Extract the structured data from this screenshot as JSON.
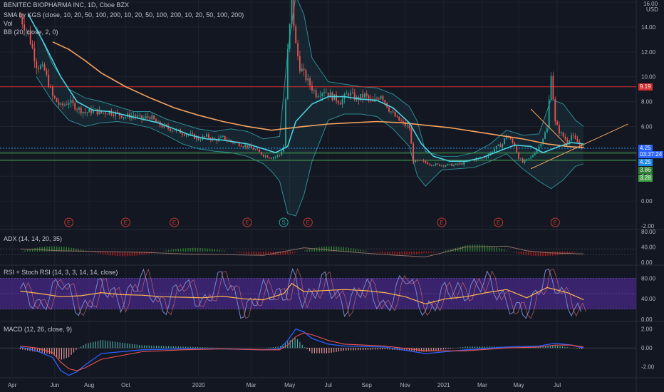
{
  "legend": {
    "title": "BENITEC BIOPHARMA INC, 1D, Cboe BZX",
    "sma": "SMA by KGS (close, 10, 20, 50, 100, 200, 10, 20, 50, 100, 200, 10, 20, 50, 100, 200)",
    "vol": "Vol",
    "bb": "BB (20, close, 2, 0)",
    "adx": "ADX (14, 14, 20, 35)",
    "rsi": "RSI + Stoch RSI (14, 3, 3, 14, 14, close)",
    "macd": "MACD (12, 26, close, 9)"
  },
  "price_tags": {
    "top": "16.00",
    "currency": "USD",
    "resistance": "9.19",
    "last": "4.25",
    "countdown": "03:37:24",
    "last2": "4.25",
    "support1": "3.86",
    "support2": "3.28"
  },
  "colors": {
    "background": "#131722",
    "grid": "#1e222d",
    "candle_up": "#26a69a",
    "candle_down": "#ef5350",
    "sma_orange": "#f5a25d",
    "sma_blue": "#4dd0e1",
    "bollinger": "#2e8b94",
    "resistance": "#d32f2f",
    "support": "#2e7d32",
    "earnings": "#c0392b",
    "rsi_band": "#4a2a8c",
    "macd_line": "#2962ff",
    "signal_line": "#ef5350"
  },
  "events": {
    "earnings_label": "E",
    "split_label": "S"
  },
  "chart_data": [
    {
      "type": "candlestick",
      "name": "price",
      "x_labels": [
        "Apr",
        "Jun",
        "Aug",
        "Oct",
        "2020",
        "Mar",
        "May",
        "Jul",
        "Sep",
        "Nov",
        "2021",
        "Mar",
        "May",
        "Jul"
      ],
      "y_ticks": [
        "16.00",
        "14.00",
        "12.00",
        "10.00",
        "8.00",
        "6.00",
        "4.00",
        "2.00",
        "0.00",
        "-2.00"
      ],
      "ylim": [
        -2,
        16
      ],
      "close_series": [
        [
          0,
          14.8
        ],
        [
          2,
          13.5
        ],
        [
          4,
          11.0
        ],
        [
          6,
          10.5
        ],
        [
          8,
          8.4
        ],
        [
          10,
          7.6
        ],
        [
          12,
          8.0
        ],
        [
          14,
          7.5
        ],
        [
          16,
          7.1
        ],
        [
          18,
          7.3
        ],
        [
          20,
          7.1
        ],
        [
          22,
          7.2
        ],
        [
          24,
          7.0
        ],
        [
          26,
          6.8
        ],
        [
          28,
          6.9
        ],
        [
          30,
          6.6
        ],
        [
          32,
          6.8
        ],
        [
          34,
          6.2
        ],
        [
          36,
          5.9
        ],
        [
          38,
          5.7
        ],
        [
          40,
          5.5
        ],
        [
          42,
          5.3
        ],
        [
          44,
          5.0
        ],
        [
          46,
          5.2
        ],
        [
          48,
          4.9
        ],
        [
          50,
          5.1
        ],
        [
          52,
          4.8
        ],
        [
          54,
          4.6
        ],
        [
          56,
          4.4
        ],
        [
          58,
          4.1
        ],
        [
          60,
          3.7
        ],
        [
          62,
          3.5
        ],
        [
          64,
          3.7
        ],
        [
          65,
          4.4
        ],
        [
          66,
          12.0
        ],
        [
          67,
          16.0
        ],
        [
          68,
          12.5
        ],
        [
          69,
          10.8
        ],
        [
          71,
          9.6
        ],
        [
          73,
          8.6
        ],
        [
          75,
          8.9
        ],
        [
          77,
          8.4
        ],
        [
          79,
          8.0
        ],
        [
          81,
          8.7
        ],
        [
          83,
          8.2
        ],
        [
          85,
          8.5
        ],
        [
          87,
          7.9
        ],
        [
          89,
          8.6
        ],
        [
          91,
          7.4
        ],
        [
          93,
          6.6
        ],
        [
          95,
          6.1
        ],
        [
          96,
          5.9
        ],
        [
          97,
          3.2
        ],
        [
          99,
          3.2
        ],
        [
          101,
          3.0
        ],
        [
          103,
          2.9
        ],
        [
          105,
          2.9
        ],
        [
          107,
          2.9
        ],
        [
          109,
          3.0
        ],
        [
          111,
          3.3
        ],
        [
          113,
          3.4
        ],
        [
          115,
          3.6
        ],
        [
          117,
          4.2
        ],
        [
          119,
          4.6
        ],
        [
          120,
          5.3
        ],
        [
          122,
          4.5
        ],
        [
          123,
          3.5
        ],
        [
          124,
          3.1
        ],
        [
          126,
          3.5
        ],
        [
          128,
          4.4
        ],
        [
          129,
          5.1
        ],
        [
          130,
          5.8
        ],
        [
          131,
          10.4
        ],
        [
          132,
          6.3
        ],
        [
          133,
          5.6
        ],
        [
          135,
          4.8
        ],
        [
          136,
          5.3
        ],
        [
          137,
          4.9
        ],
        [
          138,
          4.6
        ],
        [
          139,
          4.25
        ]
      ],
      "sma_orange": [
        [
          8,
          12.8
        ],
        [
          12,
          12.2
        ],
        [
          16,
          11.3
        ],
        [
          20,
          10.3
        ],
        [
          26,
          9.2
        ],
        [
          32,
          8.3
        ],
        [
          38,
          7.5
        ],
        [
          44,
          6.9
        ],
        [
          50,
          6.4
        ],
        [
          56,
          6.0
        ],
        [
          62,
          5.7
        ],
        [
          66,
          5.85
        ],
        [
          70,
          6.0
        ],
        [
          76,
          6.2
        ],
        [
          82,
          6.3
        ],
        [
          88,
          6.4
        ],
        [
          94,
          6.3
        ],
        [
          100,
          6.1
        ],
        [
          106,
          5.9
        ],
        [
          112,
          5.6
        ],
        [
          118,
          5.3
        ],
        [
          124,
          5.0
        ],
        [
          130,
          4.6
        ],
        [
          135,
          4.4
        ],
        [
          139,
          4.3
        ]
      ],
      "sma_blue": [
        [
          2,
          15.0
        ],
        [
          6,
          12.6
        ],
        [
          10,
          10.0
        ],
        [
          14,
          8.0
        ],
        [
          18,
          7.3
        ],
        [
          22,
          7.2
        ],
        [
          26,
          6.9
        ],
        [
          30,
          6.6
        ],
        [
          34,
          6.3
        ],
        [
          38,
          5.8
        ],
        [
          42,
          5.3
        ],
        [
          46,
          5.0
        ],
        [
          50,
          4.9
        ],
        [
          56,
          4.6
        ],
        [
          60,
          4.2
        ],
        [
          63,
          3.9
        ],
        [
          66,
          4.4
        ],
        [
          68,
          6.4
        ],
        [
          72,
          7.8
        ],
        [
          76,
          8.4
        ],
        [
          80,
          8.4
        ],
        [
          84,
          8.2
        ],
        [
          88,
          8.1
        ],
        [
          92,
          7.5
        ],
        [
          96,
          6.3
        ],
        [
          99,
          4.6
        ],
        [
          102,
          3.6
        ],
        [
          106,
          3.2
        ],
        [
          110,
          3.2
        ],
        [
          114,
          3.5
        ],
        [
          118,
          4.0
        ],
        [
          122,
          4.5
        ],
        [
          126,
          4.4
        ],
        [
          129,
          3.9
        ],
        [
          133,
          4.4
        ],
        [
          136,
          4.7
        ],
        [
          139,
          4.6
        ]
      ],
      "bb_upper": [
        [
          4,
          14.0
        ],
        [
          8,
          11.0
        ],
        [
          12,
          9.0
        ],
        [
          16,
          8.3
        ],
        [
          20,
          8.0
        ],
        [
          24,
          7.6
        ],
        [
          28,
          7.2
        ],
        [
          32,
          7.2
        ],
        [
          36,
          6.6
        ],
        [
          40,
          6.2
        ],
        [
          44,
          5.8
        ],
        [
          48,
          5.6
        ],
        [
          52,
          5.8
        ],
        [
          56,
          5.6
        ],
        [
          60,
          5.0
        ],
        [
          64,
          5.2
        ],
        [
          66,
          12.0
        ],
        [
          68,
          16.5
        ],
        [
          70,
          15.0
        ],
        [
          72,
          11.5
        ],
        [
          76,
          9.6
        ],
        [
          80,
          9.4
        ],
        [
          84,
          9.2
        ],
        [
          88,
          9.1
        ],
        [
          92,
          8.6
        ],
        [
          96,
          7.6
        ],
        [
          98,
          6.4
        ],
        [
          100,
          4.0
        ],
        [
          104,
          3.6
        ],
        [
          108,
          3.6
        ],
        [
          112,
          3.9
        ],
        [
          116,
          4.6
        ],
        [
          120,
          5.7
        ],
        [
          124,
          5.3
        ],
        [
          128,
          5.4
        ],
        [
          131,
          8.2
        ],
        [
          134,
          7.8
        ],
        [
          137,
          6.5
        ],
        [
          139,
          6.0
        ]
      ],
      "bb_lower": [
        [
          4,
          10.0
        ],
        [
          8,
          8.0
        ],
        [
          12,
          6.5
        ],
        [
          16,
          6.0
        ],
        [
          20,
          6.3
        ],
        [
          24,
          6.4
        ],
        [
          28,
          6.2
        ],
        [
          32,
          5.9
        ],
        [
          36,
          5.3
        ],
        [
          40,
          4.6
        ],
        [
          44,
          4.2
        ],
        [
          48,
          4.0
        ],
        [
          52,
          3.9
        ],
        [
          56,
          3.6
        ],
        [
          60,
          3.0
        ],
        [
          62,
          2.4
        ],
        [
          64,
          1.6
        ],
        [
          66,
          -1.0
        ],
        [
          68,
          -1.2
        ],
        [
          70,
          0.5
        ],
        [
          72,
          3.2
        ],
        [
          76,
          6.5
        ],
        [
          80,
          7.0
        ],
        [
          84,
          7.0
        ],
        [
          88,
          6.8
        ],
        [
          92,
          5.8
        ],
        [
          96,
          4.4
        ],
        [
          98,
          2.0
        ],
        [
          100,
          1.2
        ],
        [
          104,
          2.5
        ],
        [
          108,
          2.6
        ],
        [
          112,
          2.7
        ],
        [
          116,
          3.2
        ],
        [
          120,
          3.8
        ],
        [
          124,
          2.6
        ],
        [
          128,
          1.6
        ],
        [
          131,
          1.0
        ],
        [
          134,
          1.7
        ],
        [
          137,
          2.8
        ],
        [
          139,
          3.0
        ]
      ],
      "horizontal_levels": [
        {
          "value": 9.19,
          "color": "#d32f2f"
        },
        {
          "value": 3.86,
          "color": "#4caf50"
        },
        {
          "value": 3.28,
          "color": "#4caf50"
        },
        {
          "value": 4.25,
          "color": "#2196f3"
        }
      ],
      "trendlines": [
        {
          "from": [
            126,
            7.4
          ],
          "to": [
            135,
            4.45
          ]
        },
        {
          "from": [
            126,
            2.6
          ],
          "to": [
            150,
            6.2
          ]
        }
      ],
      "earnings_markers_x": [
        12,
        26,
        38,
        56,
        71,
        104,
        118,
        132
      ],
      "split_marker_x": 65
    },
    {
      "type": "line",
      "name": "adx",
      "y_ticks": [
        "80.00",
        "40.00",
        "0.00"
      ],
      "ylim": [
        0,
        80
      ],
      "x": [
        0,
        10,
        20,
        30,
        40,
        50,
        60,
        66,
        70,
        80,
        90,
        100,
        110,
        120,
        125,
        130,
        139
      ],
      "values": [
        35,
        30,
        28,
        26,
        22,
        20,
        18,
        30,
        38,
        28,
        20,
        14,
        40,
        42,
        30,
        25,
        22
      ]
    },
    {
      "type": "line",
      "name": "rsi_stoch",
      "y_ticks": [
        "80.00",
        "40.00",
        "0.00"
      ],
      "ylim": [
        0,
        100
      ],
      "band": [
        20,
        80
      ],
      "x": [
        0,
        5,
        10,
        15,
        20,
        25,
        30,
        35,
        40,
        45,
        50,
        55,
        60,
        65,
        67,
        70,
        75,
        80,
        85,
        90,
        95,
        100,
        105,
        110,
        115,
        120,
        125,
        130,
        135,
        139
      ],
      "rsi": [
        55,
        50,
        44,
        46,
        52,
        48,
        47,
        44,
        43,
        42,
        45,
        40,
        38,
        50,
        70,
        54,
        56,
        58,
        56,
        52,
        44,
        30,
        40,
        44,
        52,
        58,
        42,
        62,
        52,
        38
      ],
      "stoch": [
        60,
        20,
        80,
        10,
        70,
        30,
        85,
        15,
        75,
        25,
        90,
        10,
        60,
        40,
        95,
        30,
        80,
        20,
        70,
        15,
        90,
        10,
        60,
        50,
        80,
        30,
        10,
        95,
        30,
        5
      ]
    },
    {
      "type": "line",
      "name": "macd",
      "y_ticks": [
        "2.00",
        "0.00",
        "-2.00"
      ],
      "ylim": [
        -3,
        2.5
      ],
      "x": [
        0,
        4,
        8,
        10,
        12,
        14,
        16,
        20,
        30,
        40,
        50,
        60,
        64,
        66,
        68,
        70,
        72,
        76,
        80,
        90,
        100,
        110,
        120,
        128,
        132,
        136,
        139
      ],
      "macd": [
        0.1,
        -0.3,
        -1.0,
        -2.4,
        -2.9,
        -2.5,
        -1.8,
        -0.6,
        -0.2,
        -0.1,
        -0.1,
        -0.2,
        -0.1,
        0.8,
        2.0,
        1.7,
        1.0,
        0.4,
        0.2,
        0.1,
        -0.6,
        -0.2,
        0.1,
        0.2,
        0.5,
        0.3,
        0.0
      ],
      "signal": [
        0.2,
        0.0,
        -0.5,
        -1.5,
        -2.2,
        -2.4,
        -2.1,
        -1.2,
        -0.4,
        -0.2,
        -0.1,
        -0.2,
        -0.2,
        0.3,
        1.2,
        1.6,
        1.4,
        0.8,
        0.4,
        0.2,
        -0.3,
        -0.3,
        0.0,
        0.1,
        0.3,
        0.3,
        0.1
      ]
    }
  ]
}
